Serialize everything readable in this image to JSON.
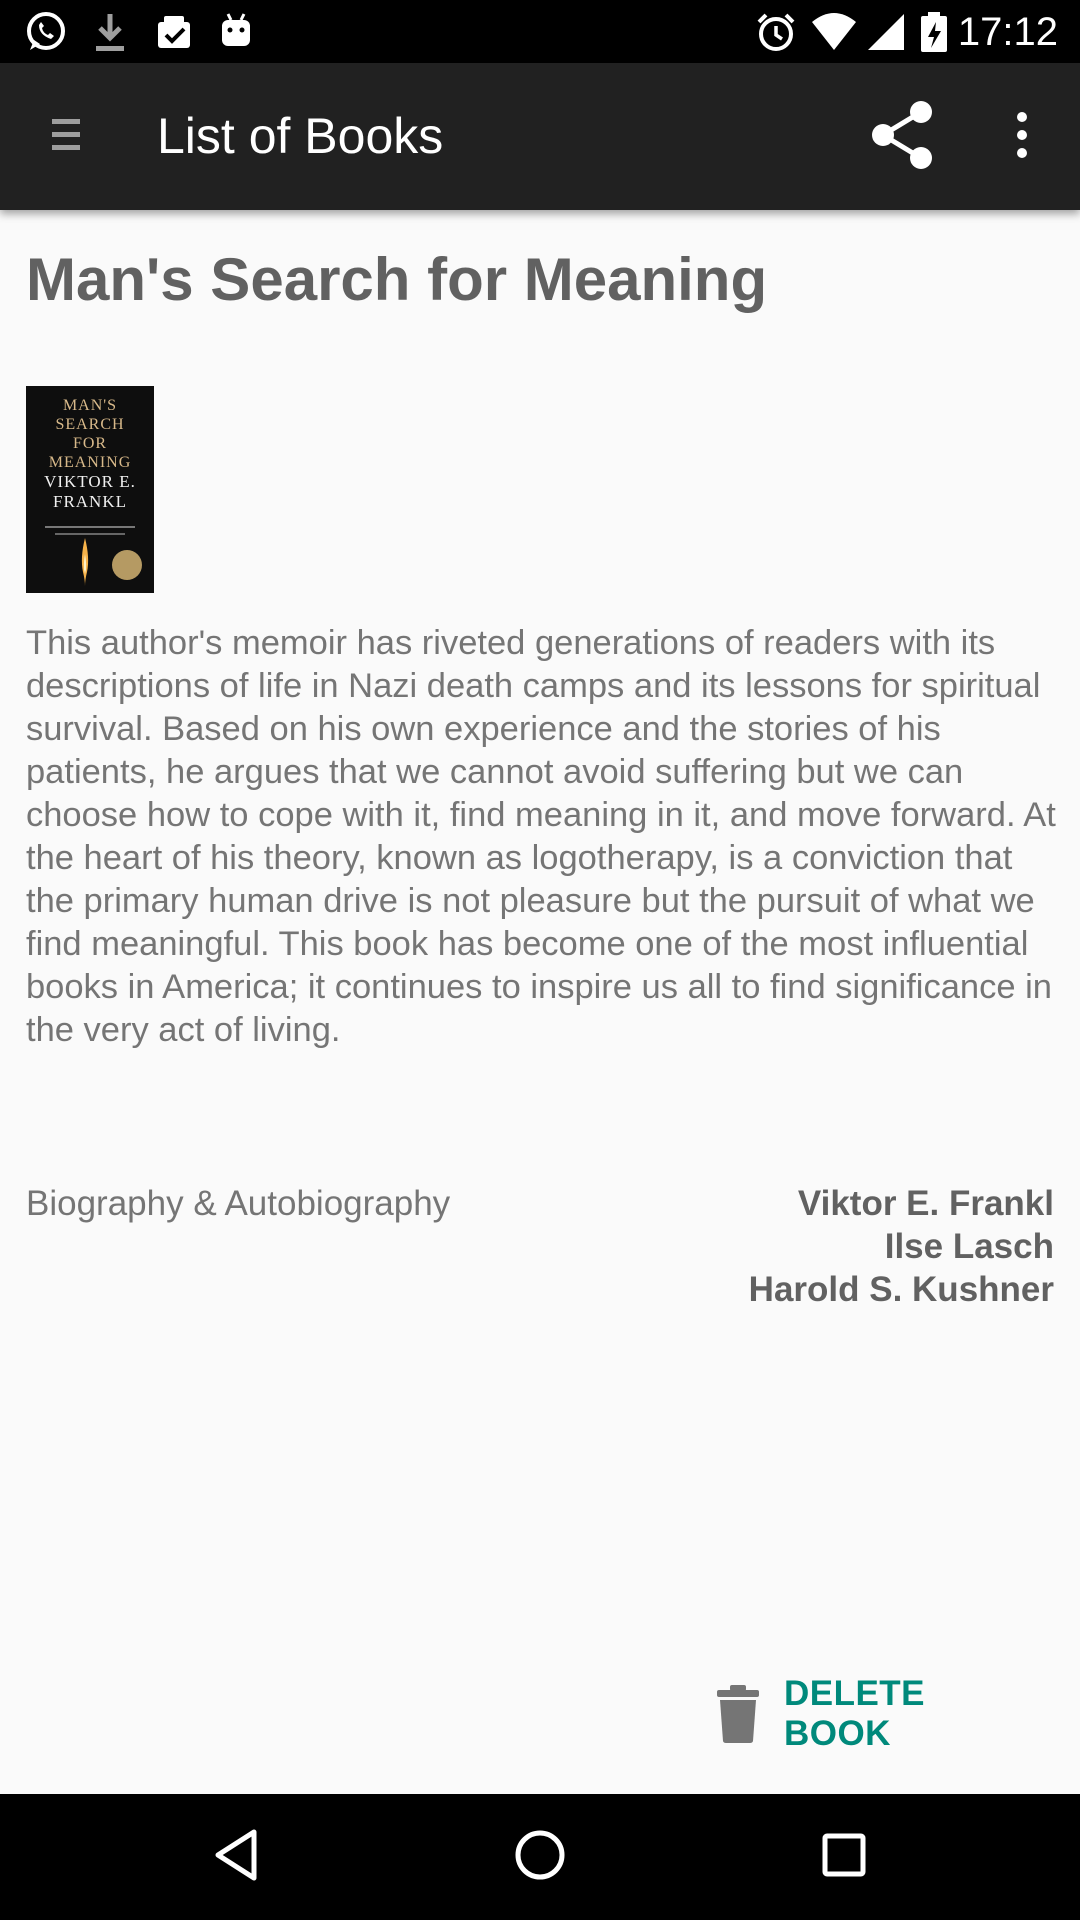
{
  "status_bar": {
    "time": "17:12",
    "left_icons": [
      "whatsapp-icon",
      "download-icon",
      "clipboard-check-icon",
      "android-icon"
    ],
    "right_icons": [
      "alarm-icon",
      "wifi-icon",
      "signal-icon",
      "battery-charging-icon"
    ]
  },
  "app_bar": {
    "title": "List of Books",
    "menu_icon": "menu-icon",
    "share_icon": "share-icon",
    "more_icon": "more-vert-icon",
    "background": "#212121"
  },
  "book": {
    "title": "Man's Search for Meaning",
    "cover": {
      "lines": [
        "MAN'S",
        "SEARCH",
        "FOR",
        "MEANING"
      ],
      "author": [
        "VIKTOR E.",
        "FRANKL"
      ]
    },
    "description": "This author's memoir has riveted generations of readers with its descriptions of life in Nazi death camps and its lessons for spiritual survival. Based on his own experience and the stories of his patients, he argues that we cannot avoid suffering but we can choose how to cope with it, find meaning in it, and move forward. At the heart of his theory, known as logotherapy, is a conviction that the primary human drive is not pleasure but the pursuit of what we find meaningful. This book has become one of the most influential books in America; it continues to inspire us all to find significance in the very act of living.",
    "category": "Biography & Autobiography",
    "authors": [
      "Viktor E. Frankl",
      "Ilse Lasch",
      "Harold S. Kushner"
    ]
  },
  "actions": {
    "delete_label": "DELETE BOOK",
    "delete_icon": "trash-icon",
    "accent": "#00897b"
  },
  "nav_bar": {
    "back_icon": "back-icon",
    "home_icon": "home-icon",
    "recents_icon": "recents-icon"
  }
}
